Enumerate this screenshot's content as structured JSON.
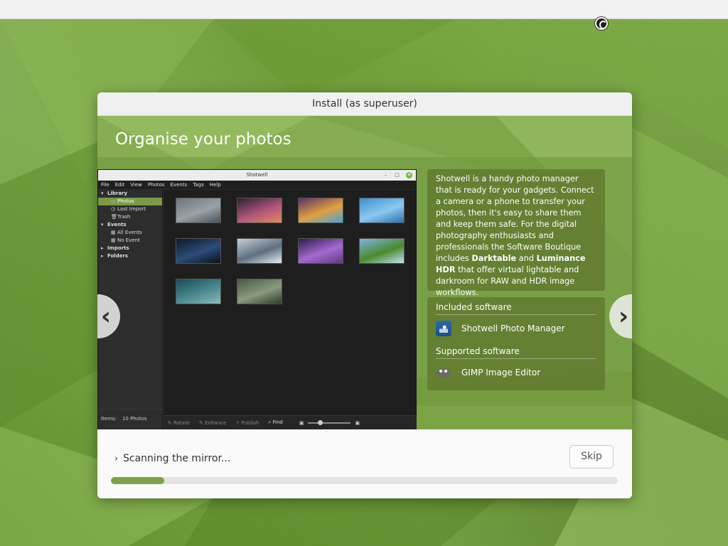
{
  "window": {
    "title": "Install (as superuser)"
  },
  "slide": {
    "title": "Organise your photos",
    "description": [
      {
        "text": "Shotwell is a handy photo manager that is ready for your gadgets. Connect a camera or a phone to transfer your photos, then it's easy to share them and keep them safe. For the digital photography enthusiasts and professionals the Software Boutique includes ",
        "bold": false
      },
      {
        "text": "Darktable",
        "bold": true
      },
      {
        "text": " and ",
        "bold": false
      },
      {
        "text": "Luminance HDR",
        "bold": true
      },
      {
        "text": " that offer virtual lightable and darkroom for RAW and HDR image workflows.",
        "bold": false
      }
    ],
    "included_heading": "Included software",
    "included_apps": [
      {
        "name": "Shotwell Photo Manager",
        "icon": "shotwell-icon"
      }
    ],
    "supported_heading": "Supported software",
    "supported_apps": [
      {
        "name": "GIMP Image Editor",
        "icon": "gimp-icon"
      }
    ],
    "prev_label": "‹",
    "next_label": "›"
  },
  "shotwell": {
    "title": "Shotwell",
    "window_controls": [
      "–",
      "□",
      "✕"
    ],
    "menu": [
      "File",
      "Edit",
      "View",
      "Photos",
      "Events",
      "Tags",
      "Help"
    ],
    "sidebar": [
      {
        "label": "Library",
        "level": 0,
        "glyph": "▾",
        "selected": false
      },
      {
        "label": "Photos",
        "level": 1,
        "glyph": "▭",
        "selected": true
      },
      {
        "label": "Last Import",
        "level": 1,
        "glyph": "◷",
        "selected": false
      },
      {
        "label": "Trash",
        "level": 1,
        "glyph": "🗑",
        "selected": false
      },
      {
        "label": "Events",
        "level": 0,
        "glyph": "▾",
        "selected": false
      },
      {
        "label": "All Events",
        "level": 1,
        "glyph": "▦",
        "selected": false
      },
      {
        "label": "No Event",
        "level": 1,
        "glyph": "▦",
        "selected": false
      },
      {
        "label": "Imports",
        "level": 0,
        "glyph": "▸",
        "selected": false
      },
      {
        "label": "Folders",
        "level": 0,
        "glyph": "▸",
        "selected": false
      }
    ],
    "items_label": "Items:",
    "items_value": "10 Photos",
    "toolbar": [
      "Rotate",
      "Enhance",
      "Publish",
      "Find"
    ],
    "toolbar_icons": [
      "rotate-icon",
      "enhance-icon",
      "publish-icon",
      "find-icon"
    ],
    "thumbnails": [
      {
        "name": "mountain-fog",
        "colors": [
          "#6f7478",
          "#9aa2a8",
          "#4a5056"
        ]
      },
      {
        "name": "dusk-peak",
        "colors": [
          "#2b2235",
          "#b0567a",
          "#e08a60"
        ]
      },
      {
        "name": "bokeh-lights",
        "colors": [
          "#5a2f6b",
          "#e0a040",
          "#4aa3d8"
        ]
      },
      {
        "name": "ocean-sky",
        "colors": [
          "#3f8fd0",
          "#8cc8ee",
          "#2a70b0"
        ]
      },
      {
        "name": "earth-night",
        "colors": [
          "#0d1826",
          "#2c4d7a",
          "#0a0f18"
        ]
      },
      {
        "name": "snow-ridge",
        "colors": [
          "#c5cdd4",
          "#5f6f80",
          "#e6ecf0"
        ]
      },
      {
        "name": "lightning-storm",
        "colors": [
          "#2b1d4a",
          "#a46ad0",
          "#5a3d80"
        ]
      },
      {
        "name": "lone-tree",
        "colors": [
          "#7fb3e0",
          "#4b8a2f",
          "#c2dff3"
        ]
      },
      {
        "name": "stormy-sea",
        "colors": [
          "#1c4a5a",
          "#4a8a90",
          "#8fb8b8"
        ]
      },
      {
        "name": "cliff-road",
        "colors": [
          "#4a5a40",
          "#8a9a80",
          "#2e3a28"
        ]
      }
    ]
  },
  "footer": {
    "status_chevron": "›",
    "status_text": "Scanning the mirror...",
    "skip_label": "Skip",
    "progress_fraction": 0.105,
    "progress_color": "#7fa04e"
  },
  "colors": {
    "accent": "#7fa04e",
    "desktop": "#6f9a3c"
  }
}
